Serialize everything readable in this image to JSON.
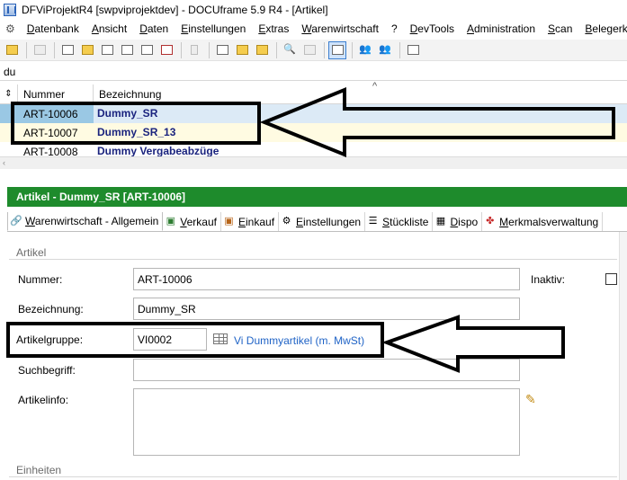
{
  "window": {
    "title": "DFViProjektR4 [swpviprojektdev] - DOCUframe 5.9 R4 - [Artikel]",
    "icon": "app-icon"
  },
  "menu": {
    "items": [
      "Datenbank",
      "Ansicht",
      "Daten",
      "Einstellungen",
      "Extras",
      "Warenwirtschaft",
      "?",
      "DevTools",
      "Administration",
      "Scan",
      "Belegerkennung"
    ]
  },
  "filter": {
    "value": "du"
  },
  "grid": {
    "columns": [
      "Nummer",
      "Bezeichnung"
    ],
    "rows": [
      {
        "nummer": "ART-10006",
        "bezeichnung": "Dummy_SR"
      },
      {
        "nummer": "ART-10007",
        "bezeichnung": "Dummy_SR_13"
      },
      {
        "nummer": "ART-10008",
        "bezeichnung": "Dummy Vergabeabzüge"
      }
    ]
  },
  "article": {
    "header": "Artikel  -  Dummy_SR [ART-10006]",
    "tabs": [
      {
        "label": "Warenwirtschaft - Allgemein",
        "icon": "link-icon"
      },
      {
        "label": "Verkauf",
        "icon": "sale-icon"
      },
      {
        "label": "Einkauf",
        "icon": "purchase-icon"
      },
      {
        "label": "Einstellungen",
        "icon": "gear-icon"
      },
      {
        "label": "Stückliste",
        "icon": "list-icon"
      },
      {
        "label": "Dispo",
        "icon": "calendar-icon"
      },
      {
        "label": "Merkmalsverwaltung",
        "icon": "features-icon"
      }
    ],
    "section_artikel": "Artikel",
    "section_einheiten": "Einheiten",
    "labels": {
      "nummer": "Nummer:",
      "bezeichnung": "Bezeichnung:",
      "artikelgruppe": "Artikelgruppe:",
      "suchbegriff": "Suchbegriff:",
      "artikelinfo": "Artikelinfo:",
      "inaktiv": "Inaktiv:"
    },
    "values": {
      "nummer": "ART-10006",
      "bezeichnung": "Dummy_SR",
      "artikelgruppe": "VI0002",
      "artikelgruppe_name": "Vi Dummyartikel (m. MwSt)",
      "suchbegriff": "",
      "artikelinfo": ""
    },
    "inaktiv_checked": false
  },
  "annotations": {
    "stroke_color": "#000000"
  }
}
